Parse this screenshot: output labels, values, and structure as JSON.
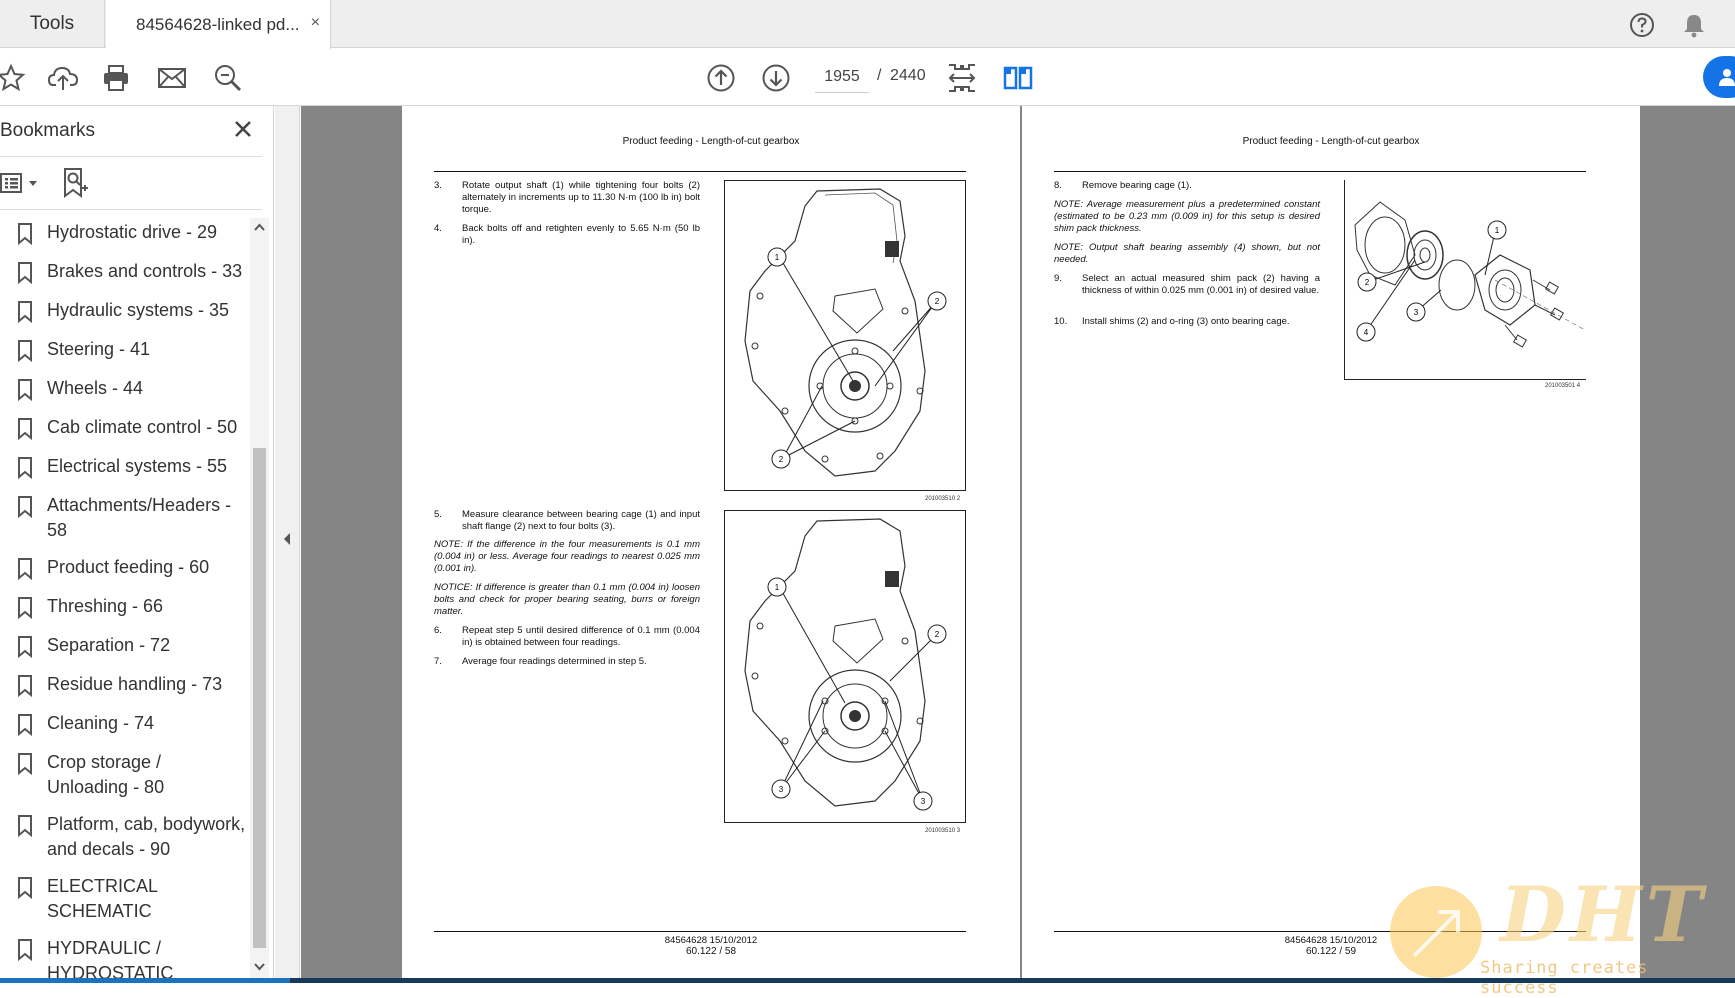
{
  "tabs": {
    "tools_label": "Tools",
    "document_label": "84564628-linked pd...",
    "close_glyph": "×"
  },
  "toolbar": {
    "icons": [
      "star-icon",
      "upload-cloud-icon",
      "print-icon",
      "mail-icon",
      "zoom-search-icon",
      "page-up-icon",
      "page-down-icon",
      "fit-page-icon",
      "two-page-view-icon"
    ],
    "current_page": "1955",
    "separator": "/",
    "total_pages": "2440"
  },
  "sidebar": {
    "title": "Bookmarks",
    "items": [
      {
        "label": "Hydrostatic drive - 29"
      },
      {
        "label": "Brakes and controls - 33"
      },
      {
        "label": "Hydraulic systems - 35"
      },
      {
        "label": "Steering - 41"
      },
      {
        "label": "Wheels - 44"
      },
      {
        "label": "Cab climate control - 50"
      },
      {
        "label": "Electrical systems - 55"
      },
      {
        "label": "Attachments/Headers - 58"
      },
      {
        "label": "Product feeding - 60"
      },
      {
        "label": "Threshing - 66"
      },
      {
        "label": "Separation - 72"
      },
      {
        "label": "Residue handling - 73"
      },
      {
        "label": "Cleaning - 74"
      },
      {
        "label": "Crop storage / Unloading - 80"
      },
      {
        "label": "Platform, cab, bodywork, and decals - 90"
      },
      {
        "label": "ELECTRICAL SCHEMATIC"
      },
      {
        "label": "HYDRAULIC / HYDROSTATIC SCHEMATIC"
      }
    ]
  },
  "left_page": {
    "header": "Product feeding - Length-of-cut gearbox",
    "steps_a": [
      {
        "num": "3.",
        "text": "Rotate output shaft (1) while tightening four bolts (2) alternately in increments up to 11.30 N·m (100 lb in) bolt torque."
      },
      {
        "num": "4.",
        "text": "Back bolts off and retighten evenly to 5.65 N·m (50 lb in)."
      }
    ],
    "fig1_ref": "201003510   2",
    "step_5": {
      "num": "5.",
      "text": "Measure clearance between bearing cage (1) and input shaft flange (2) next to four bolts (3)."
    },
    "note_1": "NOTE: If the difference in the four measurements is 0.1 mm (0.004 in) or less. Average four readings to nearest 0.025 mm (0.001 in).",
    "notice_1": "NOTICE: If difference is greater than 0.1 mm (0.004 in) loosen bolts and check for proper bearing seating, burrs or foreign matter.",
    "step_6": {
      "num": "6.",
      "text": "Repeat step 5 until desired difference of 0.1 mm (0.004 in) is obtained between four readings."
    },
    "step_7": {
      "num": "7.",
      "text": "Average four readings determined in step 5."
    },
    "fig2_ref": "201003510   3",
    "footer_line1": "84564628 15/10/2012",
    "footer_line2": "60.122 / 58"
  },
  "right_page": {
    "header": "Product feeding - Length-of-cut gearbox",
    "step_8": {
      "num": "8.",
      "text": "Remove bearing cage (1)."
    },
    "note_1": "NOTE: Average measurement plus a predetermined constant (estimated to be 0.23 mm (0.009 in) for this setup is desired shim pack thickness.",
    "note_2": "NOTE: Output shaft bearing assembly (4) shown, but not needed.",
    "step_9": {
      "num": "9.",
      "text": "Select an actual measured shim pack (2) having a thickness of within 0.025 mm (0.001 in) of desired value."
    },
    "step_10": {
      "num": "10.",
      "text": "Install shims (2) and o-ring (3) onto bearing cage."
    },
    "fig_ref": "201003501   4",
    "footer_line1": "84564628 15/10/2012",
    "footer_line2": "60.122 / 59"
  },
  "watermark": {
    "logo_text": "DHT",
    "tagline": "Sharing creates success"
  },
  "colors": {
    "accent_blue": "#1473e6",
    "doc_background": "#858585",
    "watermark_orange": "#f8c060"
  }
}
